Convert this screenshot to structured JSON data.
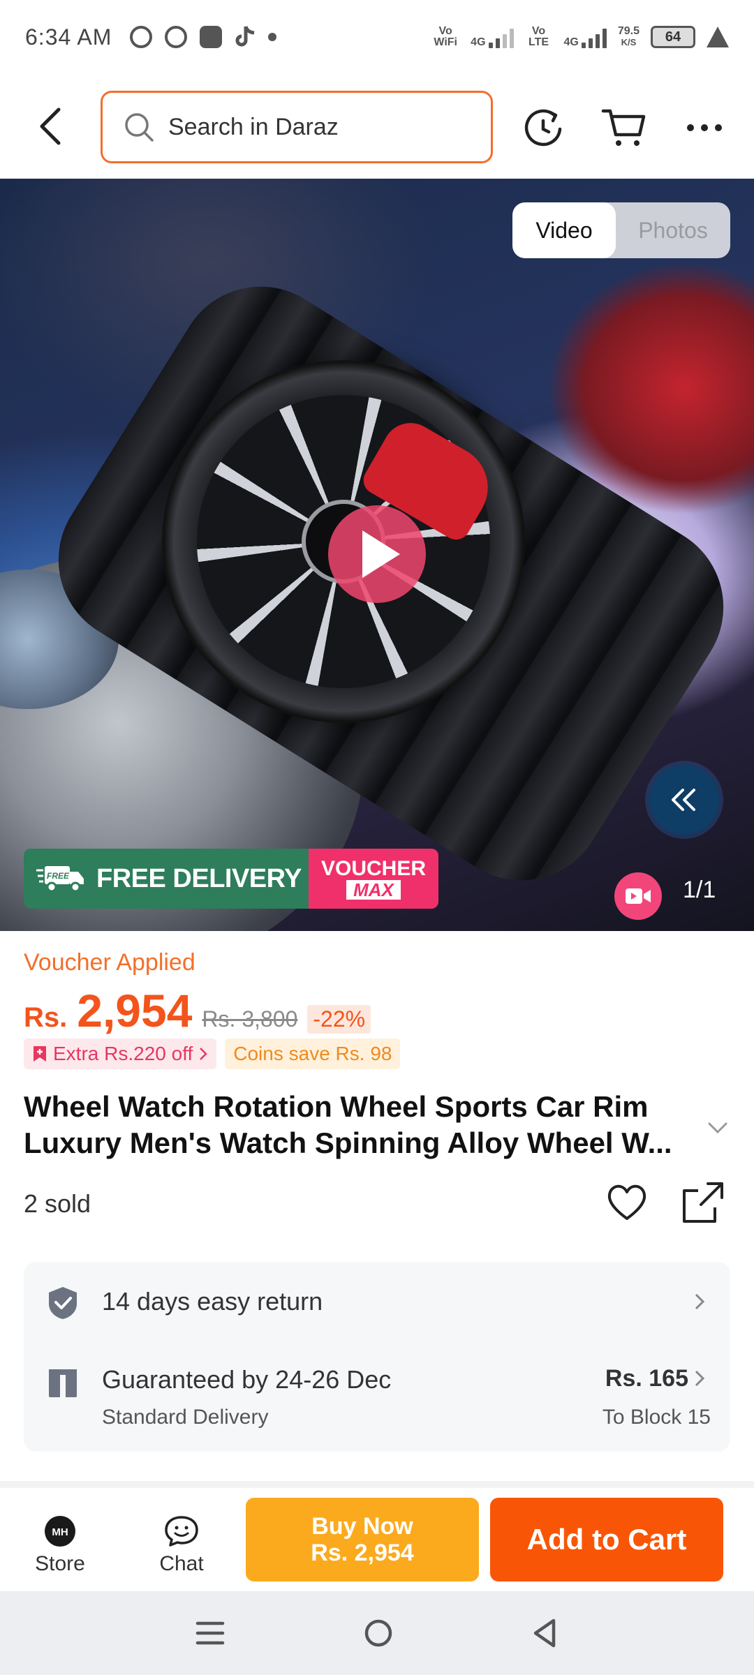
{
  "status_bar": {
    "time": "6:34 AM",
    "network_1": "Vo WiFi",
    "signal_1_label": "4G",
    "network_2": "Vo LTE",
    "signal_2_label": "4G",
    "speed_value": "79.5",
    "speed_unit": "K/S",
    "battery": "64"
  },
  "header": {
    "search_placeholder": "Search in Daraz"
  },
  "hero": {
    "tab_video": "Video",
    "tab_photos": "Photos",
    "banner_free_delivery": "FREE DELIVERY",
    "banner_free_tag": "FREE",
    "banner_voucher_line1": "VOUCHER",
    "banner_voucher_line2": "MAX",
    "counter": "1/1"
  },
  "product": {
    "voucher_applied": "Voucher Applied",
    "currency": "Rs.",
    "price": "2,954",
    "old_price": "Rs. 3,800",
    "discount": "-22%",
    "extra_off": "Extra Rs.220 off",
    "coins_save": "Coins save Rs. 98",
    "title": "Wheel Watch Rotation Wheel Sports Car Rim Luxury Men's Watch Spinning Alloy Wheel W...",
    "sold": "2 sold"
  },
  "service": {
    "return_text": "14 days easy return",
    "delivery_text": "Guaranteed by 24-26 Dec",
    "delivery_sub": "Standard Delivery",
    "delivery_fee": "Rs. 165",
    "delivery_to": "To Block 15"
  },
  "bottom_bar": {
    "store_label": "Store",
    "store_logo": "MH",
    "chat_label": "Chat",
    "buy_now_line1": "Buy Now",
    "buy_now_line2": "Rs. 2,954",
    "add_to_cart": "Add to Cart"
  },
  "colors": {
    "brand_orange": "#f85606",
    "buy_now_yellow": "#fbaa1e",
    "price_orange": "#f3541c"
  }
}
